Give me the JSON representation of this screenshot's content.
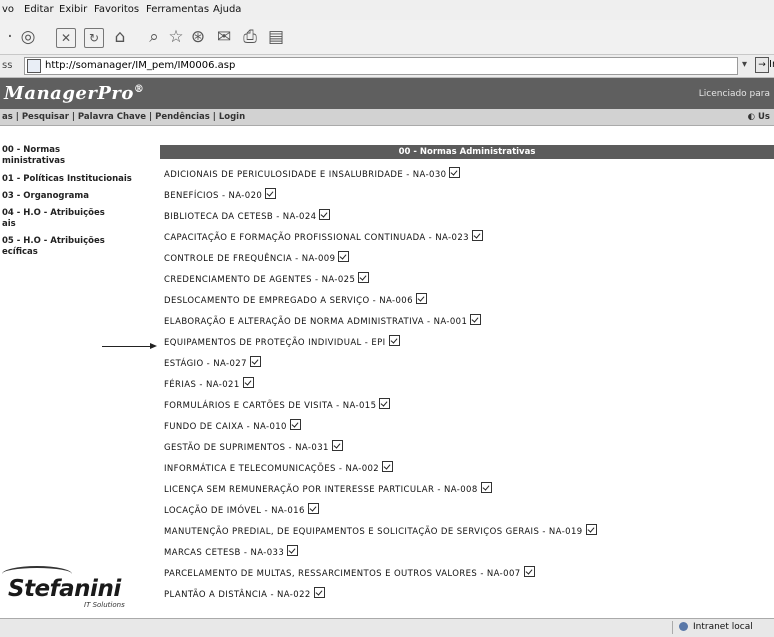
{
  "menu": [
    "vo",
    "Editar",
    "Exibir",
    "Favoritos",
    "Ferramentas",
    "Ajuda"
  ],
  "address": {
    "label": "ss",
    "url": "http://somanager/IM_pem/IM0006.asp",
    "go": "Ir"
  },
  "app": {
    "logo": "ManagerPro",
    "logo_mark": "®",
    "licensed": "Licenciado para"
  },
  "nav": {
    "text": "as | Pesquisar | Palavra Chave | Pendências | Login",
    "user": "Us"
  },
  "sidebar": [
    {
      "label": "00 - Normas\nministrativas"
    },
    {
      "label": "01 - Políticas Institucionais"
    },
    {
      "label": "03 - Organograma"
    },
    {
      "label": "04 - H.O - Atribuições\nais"
    },
    {
      "label": "05 - H.O - Atribuições\necíficas"
    }
  ],
  "section_title": "00 - Normas Administrativas",
  "documents": [
    "ADICIONAIS DE PERICULOSIDADE E INSALUBRIDADE - NA-030",
    "BENEFÍCIOS - NA-020",
    "BIBLIOTECA DA CETESB - NA-024",
    "CAPACITAÇÃO E FORMAÇÃO PROFISSIONAL CONTINUADA - NA-023",
    "CONTROLE DE FREQUÊNCIA - NA-009",
    "CREDENCIAMENTO DE AGENTES - NA-025",
    "DESLOCAMENTO DE EMPREGADO A SERVIÇO - NA-006",
    "ELABORAÇÃO E ALTERAÇÃO DE NORMA ADMINISTRATIVA - NA-001",
    "EQUIPAMENTOS DE PROTEÇÃO INDIVIDUAL - EPI",
    "ESTÁGIO - NA-027",
    "FÉRIAS - NA-021",
    "FORMULÁRIOS E CARTÕES DE VISITA - NA-015",
    "FUNDO DE CAIXA - NA-010",
    "GESTÃO DE SUPRIMENTOS - NA-031",
    "INFORMÁTICA E TELECOMUNICAÇÕES - NA-002",
    "LICENÇA SEM REMUNERAÇÃO POR INTERESSE PARTICULAR - NA-008",
    "LOCAÇÃO DE IMÓVEL - NA-016",
    "MANUTENÇÃO PREDIAL, DE EQUIPAMENTOS E SOLICITAÇÃO DE SERVIÇOS GERAIS - NA-019",
    "MARCAS CETESB - NA-033",
    "PARCELAMENTO DE MULTAS, RESSARCIMENTOS E OUTROS VALORES - NA-007",
    "PLANTÃO A DISTÂNCIA - NA-022"
  ],
  "brand": {
    "name": "Stefanini",
    "sub": "IT Solutions"
  },
  "status": {
    "zone": "Intranet local"
  }
}
